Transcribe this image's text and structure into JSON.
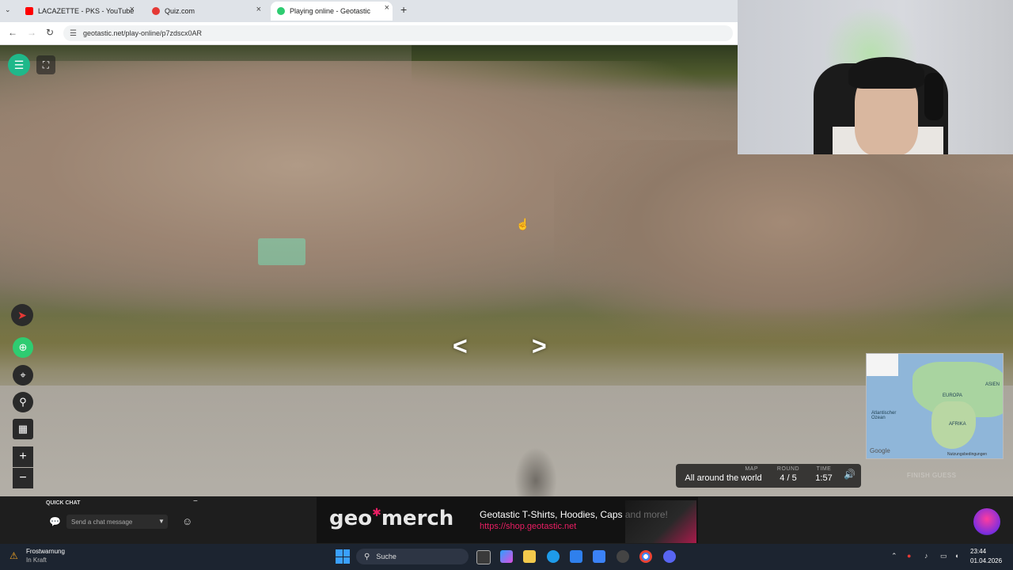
{
  "browser": {
    "tabs": [
      {
        "label": "LACAZETTE - PKS - YouTube",
        "color": "#ff0000"
      },
      {
        "label": "Quiz.com",
        "color": "#e53935"
      },
      {
        "label": "Playing online - Geotastic",
        "color": "#2ecc71"
      }
    ],
    "url": "geotastic.net/play-online/p7zdscx0AR"
  },
  "game": {
    "info": {
      "map_label": "MAP",
      "map_value": "All around the world",
      "round_label": "ROUND",
      "round_value": "4 / 5",
      "time_label": "TIME",
      "time_value": "1:57"
    },
    "finish_guess": "FINISH GUESS",
    "minimap": {
      "labels": [
        "EUROPA",
        "AFRIKA",
        "ASIEN",
        "Atlantischer Ozean"
      ],
      "attribution": "Google",
      "terms": "Nutzungsbedingungen"
    }
  },
  "chat": {
    "title": "QUICK CHAT",
    "placeholder": "Send a chat message"
  },
  "banner": {
    "brand_left": "geo",
    "brand_right": "merch",
    "line1": "Geotastic T-Shirts, Hoodies, Caps and more!",
    "line2": "https://shop.geotastic.net"
  },
  "taskbar": {
    "weather_title": "Frostwarnung",
    "weather_sub": "In Kraft",
    "search_placeholder": "Suche",
    "time": "23:44",
    "date": "01.04.2026"
  },
  "colors": {
    "accent": "#1fb88a",
    "brand_pink": "#e91e63"
  }
}
